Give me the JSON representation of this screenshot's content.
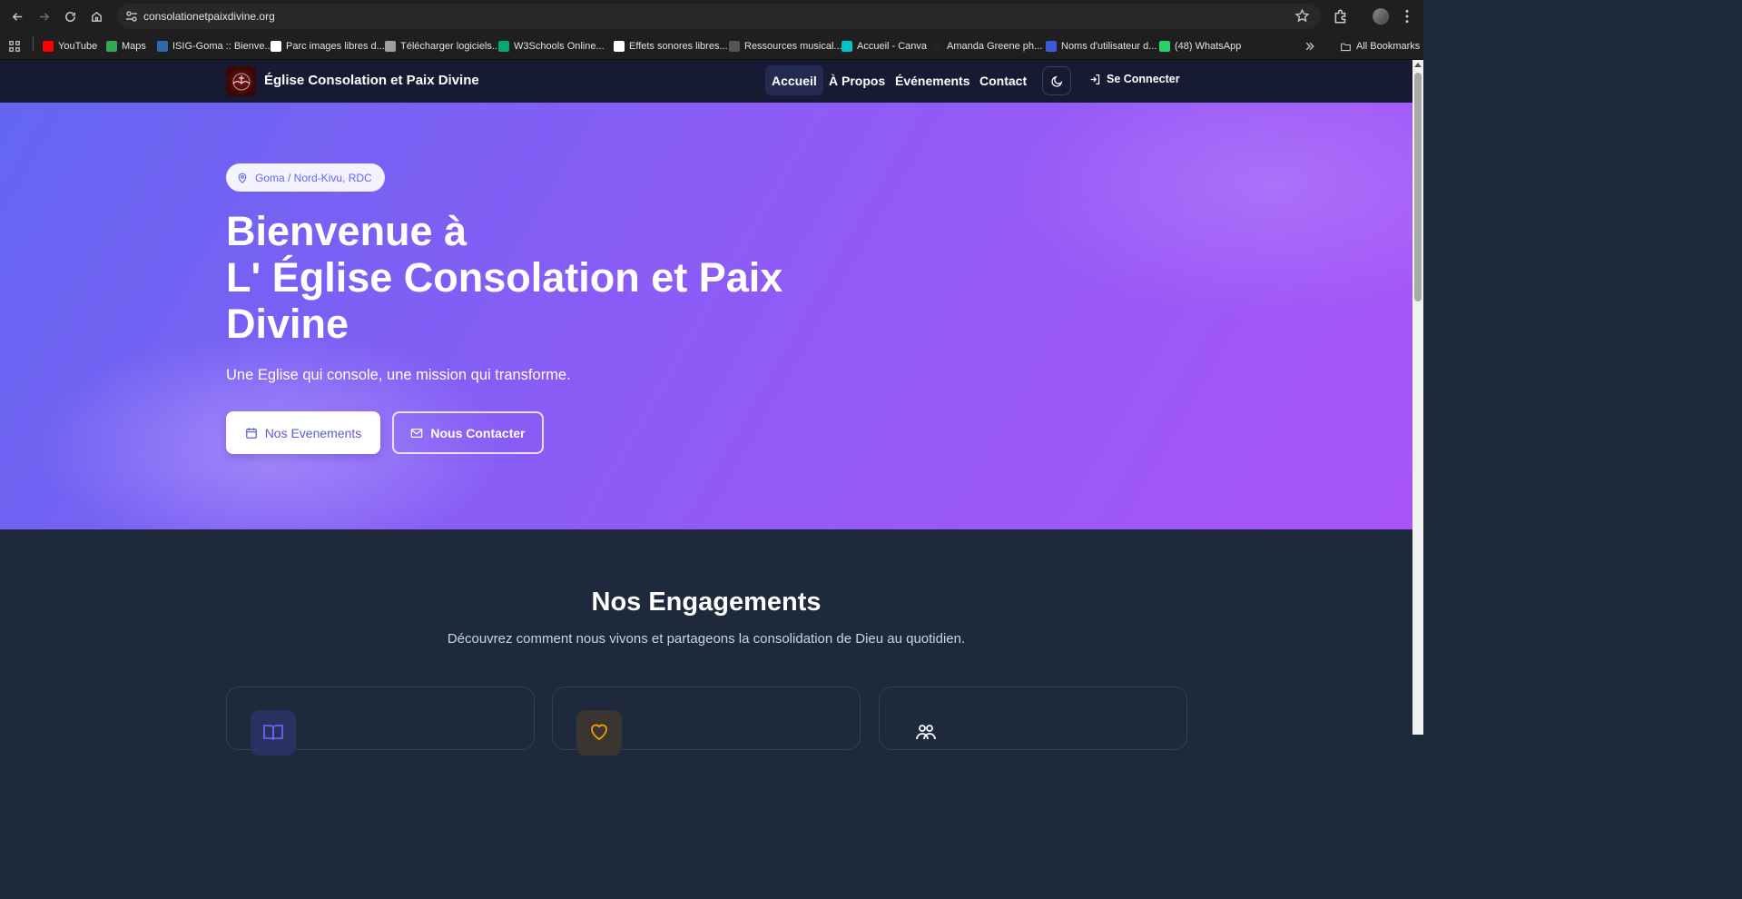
{
  "browser": {
    "url": "consolationetpaixdivine.org",
    "bookmarks": [
      {
        "label": "YouTube",
        "color": "#ff0000"
      },
      {
        "label": "Maps",
        "color": "#34a853"
      },
      {
        "label": "ISIG-Goma :: Bienve...",
        "color": "#2b6cb0"
      },
      {
        "label": "Parc images libres d...",
        "color": "#ffffff"
      },
      {
        "label": "Télécharger logiciels...",
        "color": "#9e9e9e"
      },
      {
        "label": "W3Schools Online...",
        "color": "#04aa6d"
      },
      {
        "label": "Effets sonores libres...",
        "color": "#ffffff"
      },
      {
        "label": "Ressources musical...",
        "color": "#555555"
      },
      {
        "label": "Accueil - Canva",
        "color": "#00c4cc"
      },
      {
        "label": "Amanda Greene ph...",
        "color": "#222222"
      },
      {
        "label": "Noms d'utilisateur d...",
        "color": "#3b5bdb"
      },
      {
        "label": "(48) WhatsApp",
        "color": "#25d366"
      }
    ],
    "all_bookmarks": "All Bookmarks"
  },
  "site": {
    "title": "Église Consolation et Paix Divine",
    "nav": [
      {
        "label": "Accueil",
        "active": true
      },
      {
        "label": "À Propos",
        "active": false
      },
      {
        "label": "Événements",
        "active": false
      },
      {
        "label": "Contact",
        "active": false
      }
    ],
    "login": "Se Connecter"
  },
  "hero": {
    "location": "Goma / Nord-Kivu, RDC",
    "title_lines": [
      "Bienvenue à",
      "L' Église Consolation et Paix",
      "Divine"
    ],
    "subtitle": "Une Eglise qui console, une mission qui transforme.",
    "primary_button": "Nos Evenements",
    "secondary_button": "Nous Contacter"
  },
  "engagements": {
    "title": "Nos Engagements",
    "subtitle": "Découvrez comment nous vivons et partageons la consolidation de Dieu au quotidien.",
    "cards": [
      {
        "icon": "book-icon",
        "accent": "#6366f1"
      },
      {
        "icon": "heart-icon",
        "accent": "#f59e0b"
      },
      {
        "icon": "users-icon",
        "accent": "#ffffff"
      }
    ]
  },
  "colors": {
    "hero_start": "#6366f1",
    "hero_end": "#a855f7",
    "header_bg": "#161b33",
    "section_bg": "#1e293b"
  }
}
